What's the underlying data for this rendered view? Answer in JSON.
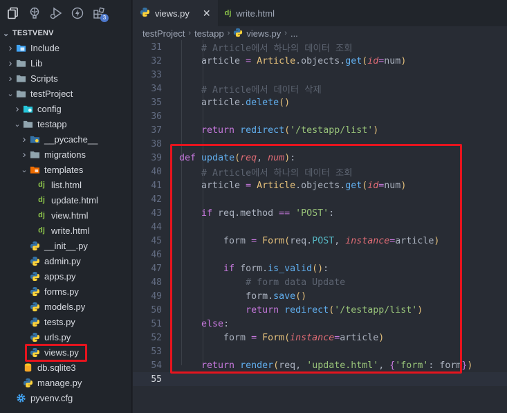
{
  "activity_bar": {
    "badge": "3"
  },
  "explorer": {
    "root": "TESTVENV",
    "items": [
      {
        "label": "Include",
        "indent": 1,
        "arrow": "right",
        "icon": "folder-include-icon"
      },
      {
        "label": "Lib",
        "indent": 1,
        "arrow": "right",
        "icon": "folder-icon"
      },
      {
        "label": "Scripts",
        "indent": 1,
        "arrow": "right",
        "icon": "folder-icon"
      },
      {
        "label": "testProject",
        "indent": 1,
        "arrow": "down",
        "icon": "folder-open-icon"
      },
      {
        "label": "config",
        "indent": 2,
        "arrow": "right",
        "icon": "folder-config-icon"
      },
      {
        "label": "testapp",
        "indent": 2,
        "arrow": "down",
        "icon": "folder-open-icon"
      },
      {
        "label": "__pycache__",
        "indent": 3,
        "arrow": "right",
        "icon": "folder-python-icon"
      },
      {
        "label": "migrations",
        "indent": 3,
        "arrow": "right",
        "icon": "folder-icon"
      },
      {
        "label": "templates",
        "indent": 3,
        "arrow": "down",
        "icon": "folder-templates-icon"
      },
      {
        "label": "list.html",
        "indent": 4,
        "arrow": "",
        "icon": "django-icon"
      },
      {
        "label": "update.html",
        "indent": 4,
        "arrow": "",
        "icon": "django-icon"
      },
      {
        "label": "view.html",
        "indent": 4,
        "arrow": "",
        "icon": "django-icon"
      },
      {
        "label": "write.html",
        "indent": 4,
        "arrow": "",
        "icon": "django-icon"
      },
      {
        "label": "__init__.py",
        "indent": 3,
        "arrow": "",
        "icon": "python-icon"
      },
      {
        "label": "admin.py",
        "indent": 3,
        "arrow": "",
        "icon": "python-icon"
      },
      {
        "label": "apps.py",
        "indent": 3,
        "arrow": "",
        "icon": "python-icon"
      },
      {
        "label": "forms.py",
        "indent": 3,
        "arrow": "",
        "icon": "python-icon"
      },
      {
        "label": "models.py",
        "indent": 3,
        "arrow": "",
        "icon": "python-icon"
      },
      {
        "label": "tests.py",
        "indent": 3,
        "arrow": "",
        "icon": "python-icon"
      },
      {
        "label": "urls.py",
        "indent": 3,
        "arrow": "",
        "icon": "python-icon"
      },
      {
        "label": "views.py",
        "indent": 3,
        "arrow": "",
        "icon": "python-icon"
      },
      {
        "label": "db.sqlite3",
        "indent": 2,
        "arrow": "",
        "icon": "database-icon"
      },
      {
        "label": "manage.py",
        "indent": 2,
        "arrow": "",
        "icon": "python-icon"
      },
      {
        "label": "pyvenv.cfg",
        "indent": 1,
        "arrow": "",
        "icon": "gear-icon"
      }
    ]
  },
  "tabs": [
    {
      "label": "views.py",
      "active": true,
      "icon": "python-icon",
      "close": "✕"
    },
    {
      "label": "write.html",
      "active": false,
      "icon": "django-icon"
    }
  ],
  "breadcrumb": [
    "testProject",
    "testapp",
    "views.py",
    "..."
  ],
  "code_lines": [
    {
      "n": "31",
      "html": "    <span class=\"cm\"># Article에서 하나의 데이터 조회</span>"
    },
    {
      "n": "32",
      "html": "    article <span class=\"op\">=</span> <span class=\"cls\">Article</span>.objects.<span class=\"fn\">get</span><span class=\"br\">(</span><span class=\"pr\">id</span><span class=\"op\">=</span>num<span class=\"br\">)</span>"
    },
    {
      "n": "33",
      "html": ""
    },
    {
      "n": "34",
      "html": "    <span class=\"cm\"># Article에서 데이터 삭제</span>"
    },
    {
      "n": "35",
      "html": "    article.<span class=\"fn\">delete</span><span class=\"br\">()</span>"
    },
    {
      "n": "36",
      "html": ""
    },
    {
      "n": "37",
      "html": "    <span class=\"kw\">return</span> <span class=\"fn\">redirect</span><span class=\"br\">(</span><span class=\"str\">'/testapp/list'</span><span class=\"br\">)</span>"
    },
    {
      "n": "38",
      "html": ""
    },
    {
      "n": "39",
      "html": "<span class=\"kw\">def</span> <span class=\"fn\">update</span><span class=\"br\">(</span><span class=\"pr\">req</span>, <span class=\"pr\">num</span><span class=\"br\">)</span>:"
    },
    {
      "n": "40",
      "html": "    <span class=\"cm\"># Article에서 하나의 데이터 조회</span>"
    },
    {
      "n": "41",
      "html": "    article <span class=\"op\">=</span> <span class=\"cls\">Article</span>.objects.<span class=\"fn\">get</span><span class=\"br\">(</span><span class=\"pr\">id</span><span class=\"op\">=</span>num<span class=\"br\">)</span>"
    },
    {
      "n": "42",
      "html": ""
    },
    {
      "n": "43",
      "html": "    <span class=\"kw\">if</span> req.method <span class=\"op\">==</span> <span class=\"str\">'POST'</span>:"
    },
    {
      "n": "44",
      "html": ""
    },
    {
      "n": "45",
      "html": "        form <span class=\"op\">=</span> <span class=\"cls\">Form</span><span class=\"br\">(</span>req.<span class=\"attr\">POST</span>, <span class=\"pr\">instance</span><span class=\"op\">=</span>article<span class=\"br\">)</span>"
    },
    {
      "n": "46",
      "html": ""
    },
    {
      "n": "47",
      "html": "        <span class=\"kw\">if</span> form.<span class=\"fn\">is_valid</span><span class=\"br\">()</span>:"
    },
    {
      "n": "48",
      "html": "            <span class=\"cm\"># form data Update</span>"
    },
    {
      "n": "49",
      "html": "            form.<span class=\"fn\">save</span><span class=\"br\">()</span>"
    },
    {
      "n": "50",
      "html": "            <span class=\"kw\">return</span> <span class=\"fn\">redirect</span><span class=\"br\">(</span><span class=\"str\">'/testapp/list'</span><span class=\"br\">)</span>"
    },
    {
      "n": "51",
      "html": "    <span class=\"kw\">else</span>:"
    },
    {
      "n": "52",
      "html": "        form <span class=\"op\">=</span> <span class=\"cls\">Form</span><span class=\"br\">(</span><span class=\"pr\">instance</span><span class=\"op\">=</span>article<span class=\"br\">)</span>"
    },
    {
      "n": "53",
      "html": ""
    },
    {
      "n": "54",
      "html": "    <span class=\"kw\">return</span> <span class=\"fn\">render</span><span class=\"br\">(</span>req, <span class=\"str\">'update.html'</span>, <span class=\"br2\">{</span><span class=\"str\">'form'</span>: form<span class=\"br2\">}</span><span class=\"br\">)</span>"
    },
    {
      "n": "55",
      "html": ""
    }
  ],
  "current_line": "55",
  "colors": {
    "highlight_box": "#e6141e",
    "python_blue": "#3572a5",
    "python_yellow": "#ffd43b",
    "django_green": "#8bc34a"
  }
}
